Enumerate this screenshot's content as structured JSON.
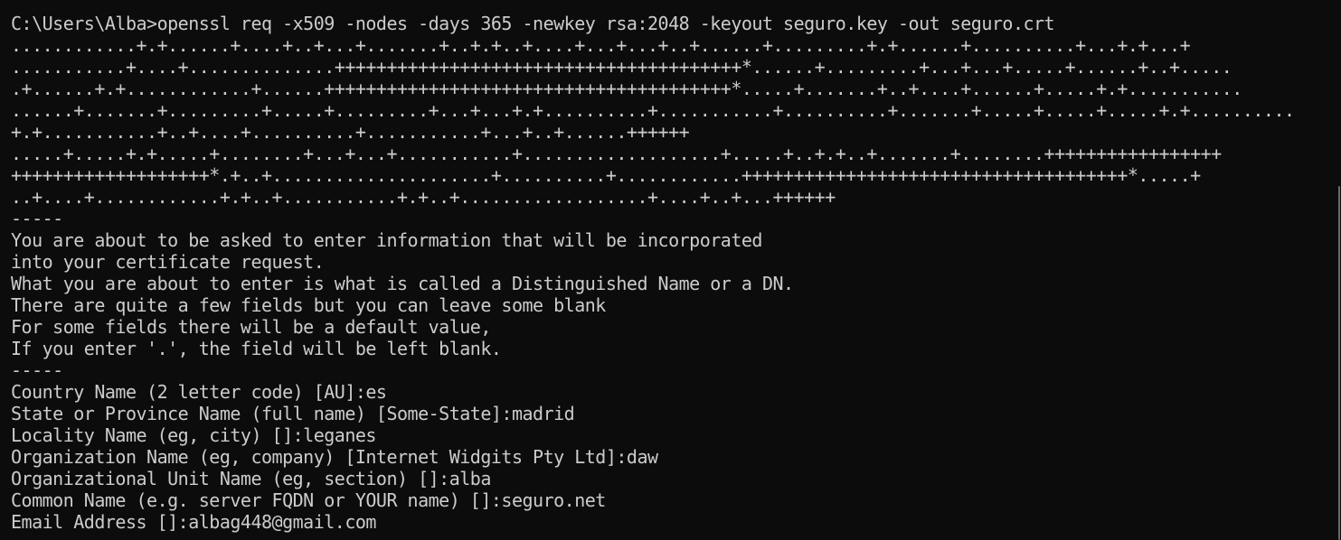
{
  "terminal": {
    "lines": [
      "C:\\Users\\Alba>openssl req -x509 -nodes -days 365 -newkey rsa:2048 -keyout seguro.key -out seguro.crt",
      "............+.+......+....+..+...+.......+..+.+..+....+...+...+..+......+.........+.+......+..........+...+.+...+",
      "...........+....+..............+++++++++++++++++++++++++++++++++++++++*......+.........+...+...+.....+......+..+.....",
      ".+......+.+............+......+++++++++++++++++++++++++++++++++++++++*.....+.......+..+....+......+.....+.+...........",
      "......+.......+.........+.....+.........+...+...+.+..........+...........+..........+.......+.....+.....+.....+.+..........",
      "+.+...........+..+....+..........+...........+...+..+......++++++",
      ".....+.....+.+.....+........+...+...+...........+...................+.....+..+.+..+.......+........+++++++++++++++++",
      "+++++++++++++++++++*.+..+.....................+..........+............+++++++++++++++++++++++++++++++++++++*.....+",
      "..+....+............+.+..+...........+.+..+..................+....+..+...++++++",
      "-----",
      "You are about to be asked to enter information that will be incorporated",
      "into your certificate request.",
      "What you are about to enter is what is called a Distinguished Name or a DN.",
      "There are quite a few fields but you can leave some blank",
      "For some fields there will be a default value,",
      "If you enter '.', the field will be left blank.",
      "-----",
      "Country Name (2 letter code) [AU]:es",
      "State or Province Name (full name) [Some-State]:madrid",
      "Locality Name (eg, city) []:leganes",
      "Organization Name (eg, company) [Internet Widgits Pty Ltd]:daw",
      "Organizational Unit Name (eg, section) []:alba",
      "Common Name (e.g. server FQDN or YOUR name) []:seguro.net",
      "Email Address []:albag448@gmail.com"
    ]
  },
  "colors": {
    "background": "#0c0c0c",
    "text": "#cccccc",
    "scrollbar": "#6b6b6b"
  }
}
